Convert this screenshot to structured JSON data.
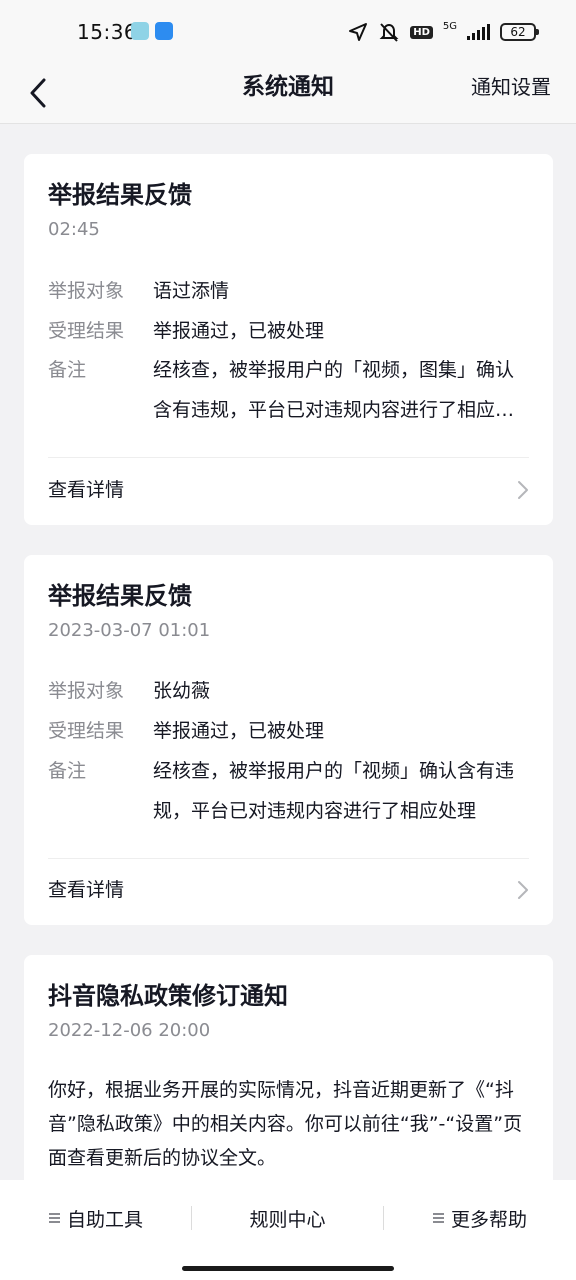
{
  "status_bar": {
    "time": "15:36",
    "hd": "HD",
    "network": "5G",
    "battery": "62"
  },
  "nav": {
    "title": "系统通知",
    "settings": "通知设置"
  },
  "cards": [
    {
      "title": "举报结果反馈",
      "time": "02:45",
      "rows": [
        {
          "key": "举报对象",
          "value": "语过添情"
        },
        {
          "key": "受理结果",
          "value": "举报通过，已被处理"
        },
        {
          "key": "备注",
          "value": "经核查，被举报用户的「视频，图集」确认含有违规，平台已对违规内容进行了相应处理"
        }
      ],
      "detail_label": "查看详情"
    },
    {
      "title": "举报结果反馈",
      "time": "2023-03-07 01:01",
      "rows": [
        {
          "key": "举报对象",
          "value": "张幼薇"
        },
        {
          "key": "受理结果",
          "value": "举报通过，已被处理"
        },
        {
          "key": "备注",
          "value": "经核查，被举报用户的「视频」确认含有违规，平台已对违规内容进行了相应处理"
        }
      ],
      "detail_label": "查看详情"
    },
    {
      "title": "抖音隐私政策修订通知",
      "time": "2022-12-06 20:00",
      "body": "你好，根据业务开展的实际情况，抖音近期更新了《“抖音”隐私政策》中的相关内容。你可以前往“我”-“设置”页面查看更新后的协议全文。"
    }
  ],
  "bottom_bar": {
    "self_service": "自助工具",
    "rules_center": "规则中心",
    "more_help": "更多帮助"
  },
  "colors": {
    "background": "#f2f2f4",
    "card": "#ffffff",
    "text_primary": "#161823",
    "text_secondary": "#8a8b91"
  }
}
